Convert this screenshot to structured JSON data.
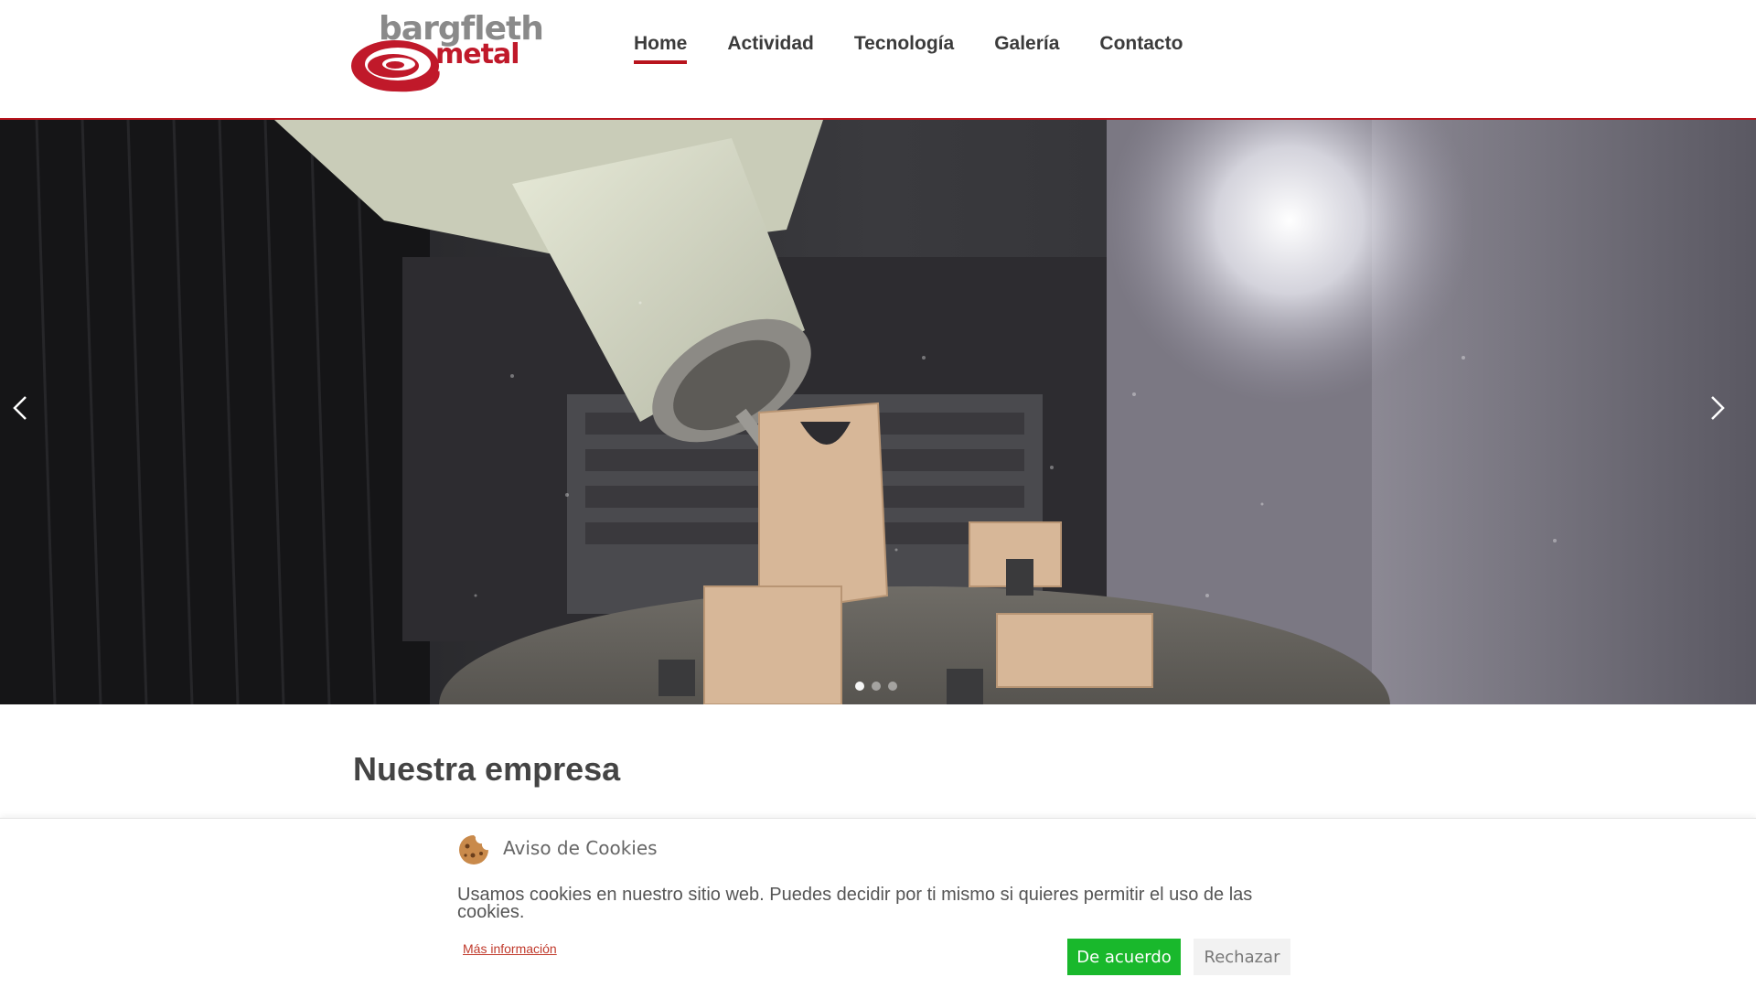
{
  "logo": {
    "line1": "bargfleth",
    "line2": "metal"
  },
  "nav": {
    "items": [
      {
        "label": "Home",
        "active": true
      },
      {
        "label": "Actividad",
        "active": false
      },
      {
        "label": "Tecnología",
        "active": false
      },
      {
        "label": "Galería",
        "active": false
      },
      {
        "label": "Contacto",
        "active": false
      }
    ]
  },
  "hero": {
    "slide_count": 3,
    "active_slide": 1
  },
  "section": {
    "title": "Nuestra empresa"
  },
  "cookie": {
    "title": "Aviso de Cookies",
    "text": "Usamos cookies en nuestro sitio web. Puedes decidir por ti mismo si quieres permitir el uso de las cookies.",
    "more_link": "Más información",
    "accept_label": "De acuerdo",
    "reject_label": "Rechazar"
  },
  "colors": {
    "accent": "#b8141d",
    "accept_green": "#19b82c"
  }
}
